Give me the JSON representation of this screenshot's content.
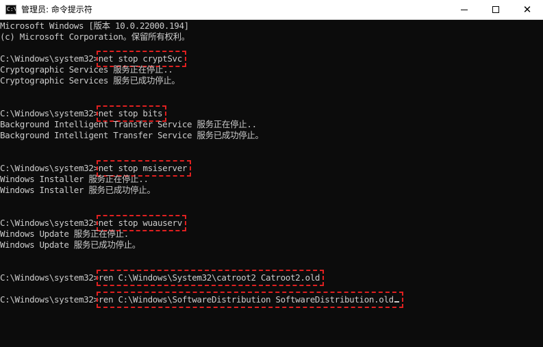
{
  "window": {
    "title": "管理员: 命令提示符",
    "icon_label": "C:\\",
    "controls": {
      "minimize": "minimize-icon",
      "maximize": "maximize-icon",
      "close_glyph": "✕"
    }
  },
  "console": {
    "lines": [
      {
        "text": "Microsoft Windows [版本 10.0.22000.194]"
      },
      {
        "text": "(c) Microsoft Corporation。保留所有权利。"
      },
      {
        "text": ""
      },
      {
        "prompt": "C:\\Windows\\system32>",
        "cmd": "net stop cryptSvc"
      },
      {
        "text": "Cryptographic Services 服务正在停止.."
      },
      {
        "text": "Cryptographic Services 服务已成功停止。"
      },
      {
        "text": ""
      },
      {
        "text": ""
      },
      {
        "prompt": "C:\\Windows\\system32>",
        "cmd": "net stop bits"
      },
      {
        "text": "Background Intelligent Transfer Service 服务正在停止.."
      },
      {
        "text": "Background Intelligent Transfer Service 服务已成功停止。"
      },
      {
        "text": ""
      },
      {
        "text": ""
      },
      {
        "prompt": "C:\\Windows\\system32>",
        "cmd": "net stop msiserver"
      },
      {
        "text": "Windows Installer 服务正在停止.."
      },
      {
        "text": "Windows Installer 服务已成功停止。"
      },
      {
        "text": ""
      },
      {
        "text": ""
      },
      {
        "prompt": "C:\\Windows\\system32>",
        "cmd": "net stop wuauserv"
      },
      {
        "text": "Windows Update 服务正在停止."
      },
      {
        "text": "Windows Update 服务已成功停止。"
      },
      {
        "text": ""
      },
      {
        "text": ""
      },
      {
        "prompt": "C:\\Windows\\system32>",
        "cmd": "ren C:\\Windows\\System32\\catroot2 Catroot2.old"
      },
      {
        "text": ""
      },
      {
        "prompt": "C:\\Windows\\system32>",
        "cmd": "ren C:\\Windows\\SoftwareDistribution SoftwareDistribution.old"
      }
    ]
  },
  "colors": {
    "console_bg": "#0c0c0c",
    "console_text": "#cccccc",
    "highlight": "#e02020",
    "titlebar_bg": "#ffffff"
  }
}
